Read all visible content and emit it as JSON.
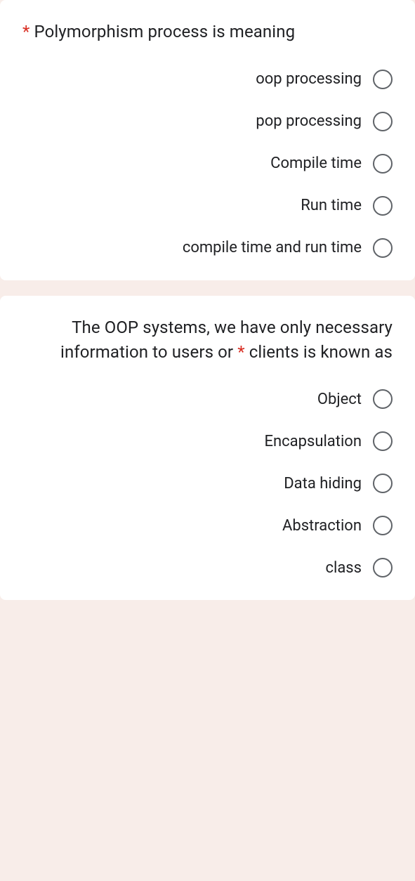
{
  "required_marker": "*",
  "questions": [
    {
      "text": "Polymorphism process is meaning",
      "options": [
        "oop processing",
        "pop processing",
        "Compile time",
        "Run time",
        "compile time and run time"
      ]
    },
    {
      "text": "The OOP systems, we have only necessary information to users or clients is known as",
      "text_before": "The OOP systems, we have only necessary information to users or ",
      "text_after": "clients is known as",
      "options": [
        "Object",
        "Encapsulation",
        "Data hiding",
        "Abstraction",
        "class"
      ]
    }
  ]
}
